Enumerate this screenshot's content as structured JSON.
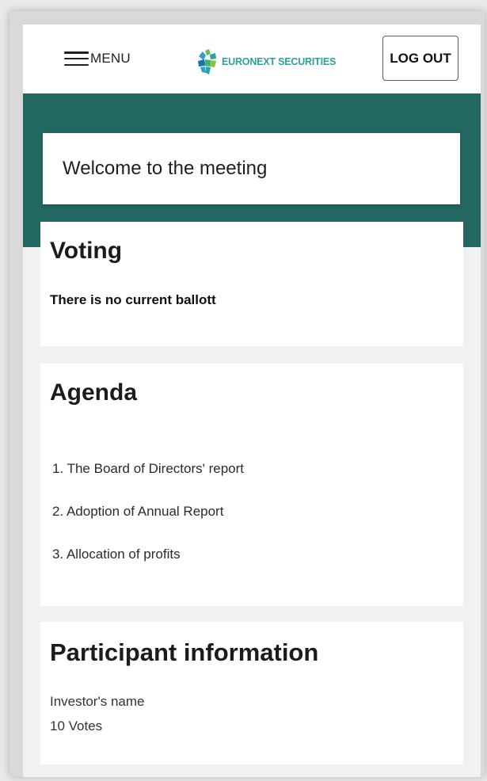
{
  "header": {
    "menu_label": "MENU",
    "logo_text": "EURONEXT SECURITIES",
    "logout_label": "LOG OUT"
  },
  "welcome": {
    "text": "Welcome to the meeting"
  },
  "voting": {
    "title": "Voting",
    "status": "There is no current ballott"
  },
  "agenda": {
    "title": "Agenda",
    "items": [
      "1. The Board of Directors' report",
      "2. Adoption of Annual Report",
      "3. Allocation of profits"
    ]
  },
  "participant": {
    "title": "Participant information",
    "name": "Investor's name",
    "votes": "10 Votes"
  },
  "colors": {
    "brand_green": "#226860",
    "logo_teal": "#2aa39a",
    "background": "#f1f1f1"
  },
  "icons": {
    "menu": "hamburger-icon",
    "logo": "euronext-logo-icon"
  }
}
